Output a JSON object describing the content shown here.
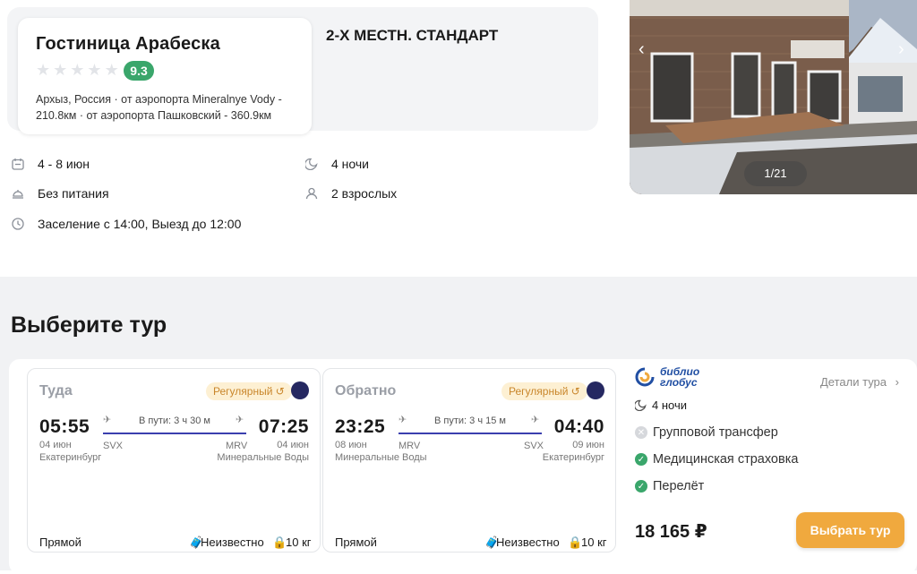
{
  "hotel": {
    "name": "Гостиница Арабеска",
    "stars_filled": 0,
    "stars_total": 5,
    "rating": "9.3",
    "location_line1": "Архыз, Россия · от аэропорта Mineralnye Vody -",
    "location_line2": "210.8км · от аэропорта Пашковский - 360.9км",
    "room_type": "2-Х МЕСТН. СТАНДАРТ"
  },
  "details": {
    "dates": "4 - 8 июн",
    "nights": "4 ночи",
    "meal": "Без питания",
    "guests": "2 взрослых",
    "checkin": "Заселение с 14:00, Выезд до 12:00"
  },
  "gallery": {
    "counter": "1/21"
  },
  "section": {
    "title": "Выберите тур"
  },
  "flights": [
    {
      "direction": "Туда",
      "badge": "Регулярный",
      "depart_time": "05:55",
      "depart_date": "04 июн",
      "depart_city": "Екатеринбург",
      "depart_code": "SVX",
      "duration": "В пути: 3 ч 30 м",
      "arrive_time": "07:25",
      "arrive_date": "04 июн",
      "arrive_city": "Минеральные Воды",
      "arrive_code": "MRV",
      "type": "Прямой",
      "baggage": "Неизвестно",
      "hand_luggage": "10 кг"
    },
    {
      "direction": "Обратно",
      "badge": "Регулярный",
      "depart_time": "23:25",
      "depart_date": "08 июн",
      "depart_city": "Минеральные Воды",
      "depart_code": "MRV",
      "duration": "В пути: 3 ч 15 м",
      "arrive_time": "04:40",
      "arrive_date": "09 июн",
      "arrive_city": "Екатеринбург",
      "arrive_code": "SVX",
      "type": "Прямой",
      "baggage": "Неизвестно",
      "hand_luggage": "10 кг"
    }
  ],
  "tour": {
    "agency_line1": "библио",
    "agency_line2": "глобус",
    "details_link": "Детали тура",
    "nights": "4 ночи",
    "included": [
      {
        "label": "Групповой трансфер",
        "included": false
      },
      {
        "label": "Медицинская страховка",
        "included": true
      },
      {
        "label": "Перелёт",
        "included": true
      }
    ],
    "price": "18 165 ₽",
    "button": "Выбрать тур"
  },
  "colors": {
    "accent": "#f0a93e",
    "rating": "#3aa66b",
    "route_line": "#3b3fae",
    "check": "#3aa66b"
  },
  "icons": [
    "calendar-icon",
    "moon-icon",
    "meal-icon",
    "person-icon",
    "clock-icon",
    "chevron-left-icon",
    "chevron-right-icon",
    "plane-takeoff-icon",
    "plane-landing-icon",
    "suitcase-icon",
    "bag-icon",
    "check-circle-icon",
    "cross-circle-icon",
    "chevron-right-icon"
  ]
}
